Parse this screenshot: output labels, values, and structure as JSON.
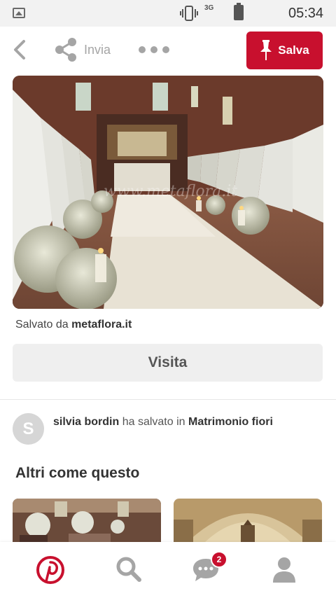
{
  "status_bar": {
    "network": "3G",
    "time": "05:34",
    "icons": [
      "image-icon",
      "vibrate-icon",
      "signal-3g-icon",
      "battery-icon"
    ]
  },
  "toolbar": {
    "back_icon": "chevron-left-icon",
    "share_label": "Invia",
    "share_icon": "share-icon",
    "more_icon": "ellipsis-icon",
    "save_label": "Salva",
    "save_icon": "pushpin-icon"
  },
  "pin": {
    "watermark": "www.metaflora.it",
    "saved_from_prefix": "Salvato da",
    "saved_from_source": "metaflora.it",
    "visit_label": "Visita"
  },
  "saver": {
    "avatar_letter": "S",
    "name": "silvia bordin",
    "action": "ha salvato in",
    "board": "Matrimonio fiori"
  },
  "related": {
    "title": "Altri come questo"
  },
  "bottom_nav": {
    "items": [
      "pinterest-logo-icon",
      "search-icon",
      "messages-icon",
      "profile-icon"
    ],
    "messages_badge": "2"
  },
  "colors": {
    "accent": "#c8102e",
    "button_grey": "#efefef",
    "icon_grey": "#a5a5a5"
  }
}
